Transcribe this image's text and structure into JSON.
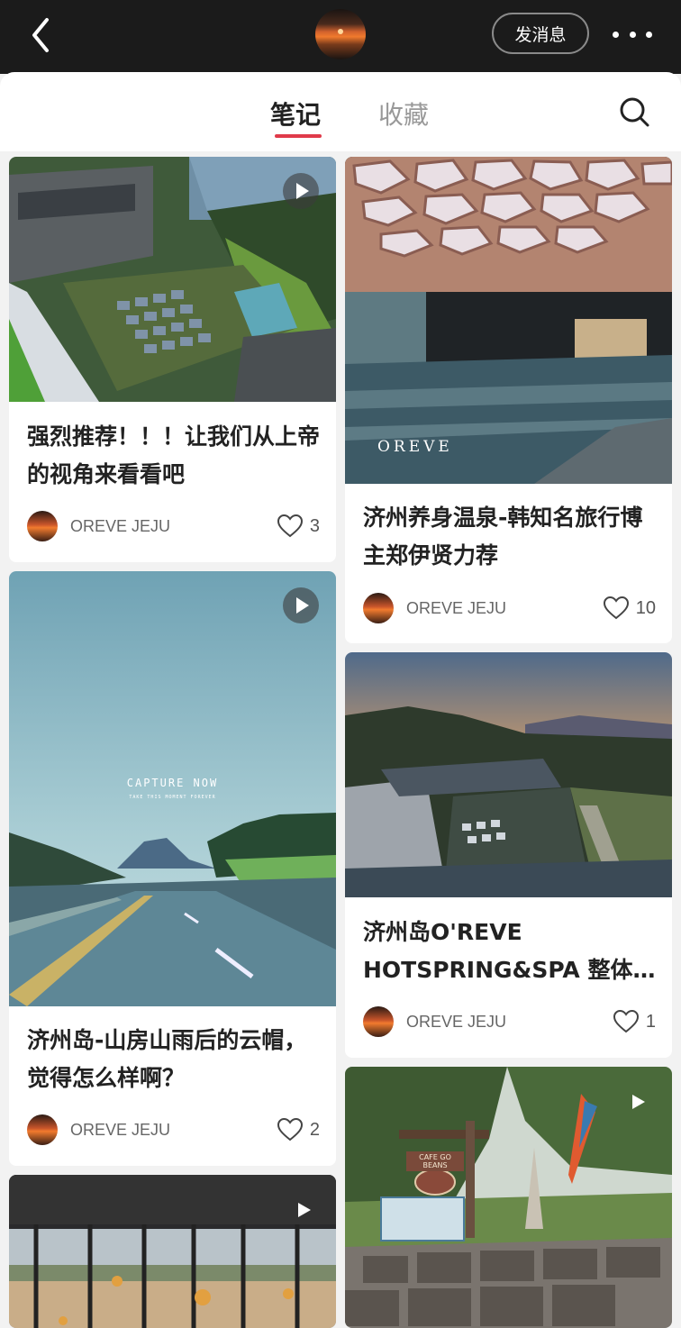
{
  "header": {
    "message_button": "发消息",
    "back_icon": "chevron-left-icon",
    "more_icon": "more-dots-icon"
  },
  "tabs": [
    {
      "label": "笔记",
      "active": true
    },
    {
      "label": "收藏",
      "active": false
    }
  ],
  "accent_color": "#e03a4a",
  "notes": [
    {
      "title": "强烈推荐！！！让我们从上帝的视角来看看吧",
      "author": "OREVE JEJU",
      "likes": "3",
      "video": true
    },
    {
      "title": "济州养身温泉-韩知名旅行博主郑伊贤力荐",
      "author": "OREVE JEJU",
      "likes": "10",
      "video": false,
      "watermark": "OREVE"
    },
    {
      "title": "济州岛-山房山雨后的云帽，觉得怎么样啊？",
      "author": "OREVE JEJU",
      "likes": "2",
      "video": true,
      "overlay_title": "CAPTURE  NOW",
      "overlay_sub": "TAKE THIS MOMENT FOREVER"
    },
    {
      "title": "济州岛O'REVE HOTSPRING&SPA 整体环境",
      "author": "OREVE JEJU",
      "likes": "1",
      "video": false
    },
    {
      "title": "",
      "video": true
    },
    {
      "title": "",
      "video": true,
      "sign_text": "CAFE GO BEANS"
    }
  ]
}
